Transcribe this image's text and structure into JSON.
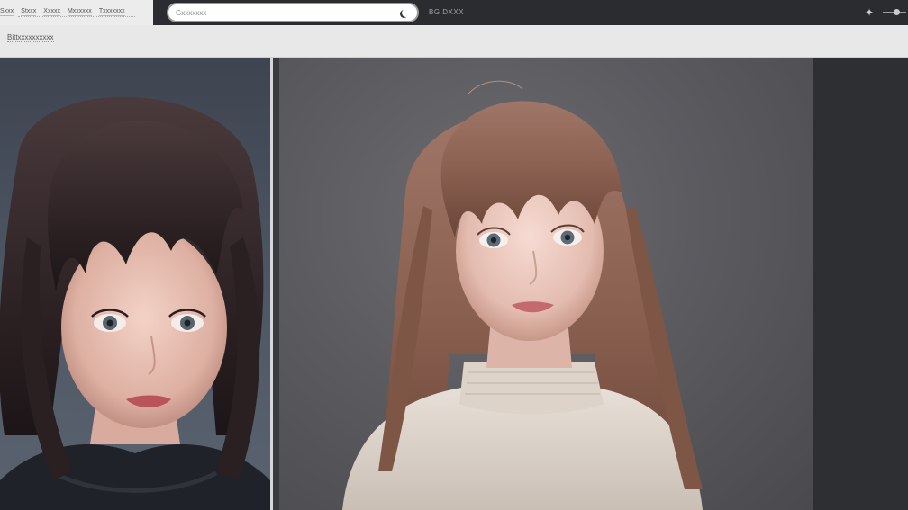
{
  "topbar": {
    "nav_links": [
      "Sxxx",
      "Stxxx",
      "Xxxxx",
      "Mxxxxxx",
      "Txxxxxxx"
    ],
    "search_placeholder": "Gxxxxxxx",
    "chip_label": "BG  DXXX"
  },
  "strip": {
    "title": "Bittxxxxxxxxxx"
  },
  "images": {
    "left_alt": "Portrait of a girl with dark brown hair and bangs wearing a black sweater",
    "right_alt": "Portrait of a girl with light brown hair and bangs wearing a cream turtleneck sweater"
  },
  "icons": [
    "moon-icon",
    "sparkle-icon",
    "slider-icon"
  ],
  "colors": {
    "topbar_bg": "#2b2c30",
    "strip_bg": "#e8e8e8",
    "left_bg": "#4c5562",
    "right_bg": "#5b5b60"
  }
}
